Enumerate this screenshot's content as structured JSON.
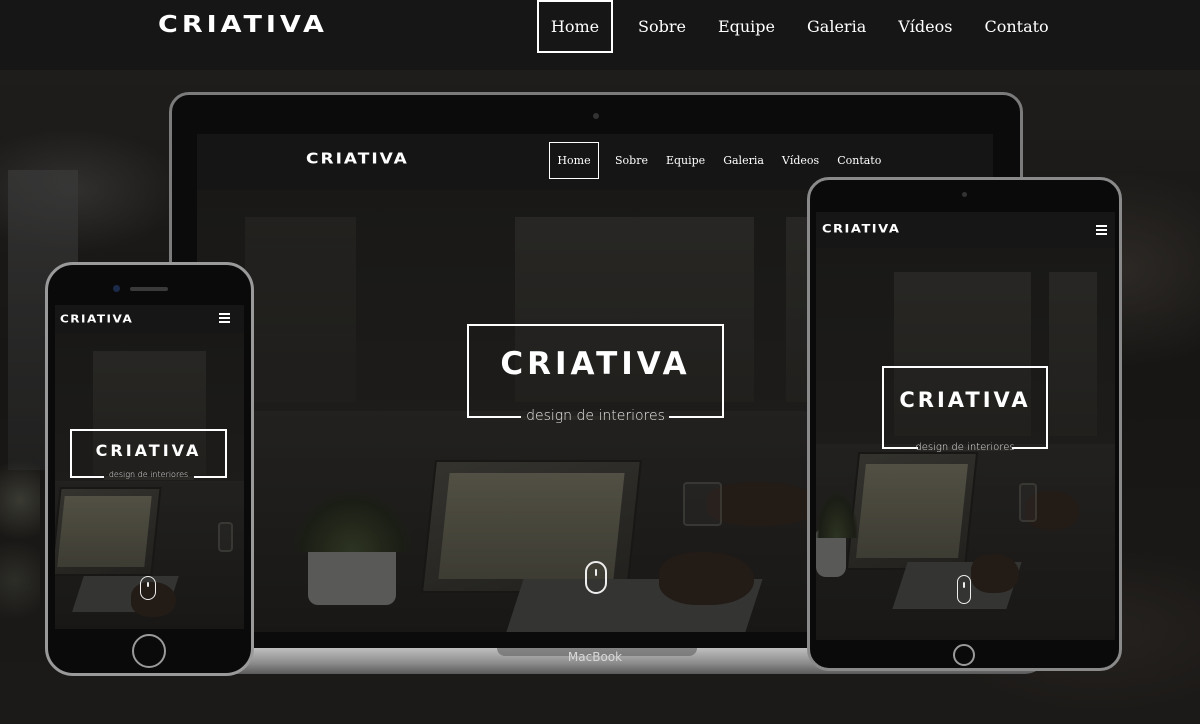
{
  "site": {
    "brand": "CRIATIVA",
    "tagline": "design de interiores"
  },
  "nav": {
    "items": [
      {
        "label": "Home",
        "active": true
      },
      {
        "label": "Sobre",
        "active": false
      },
      {
        "label": "Equipe",
        "active": false
      },
      {
        "label": "Galeria",
        "active": false
      },
      {
        "label": "Vídeos",
        "active": false
      },
      {
        "label": "Contato",
        "active": false
      }
    ]
  },
  "devices": {
    "laptop_label": "MacBook"
  },
  "icons": {
    "menu": "hamburger-icon",
    "scroll": "mouse-icon"
  },
  "colors": {
    "navbar": "#161616",
    "text": "#ffffff",
    "accent_border": "#ffffff"
  }
}
